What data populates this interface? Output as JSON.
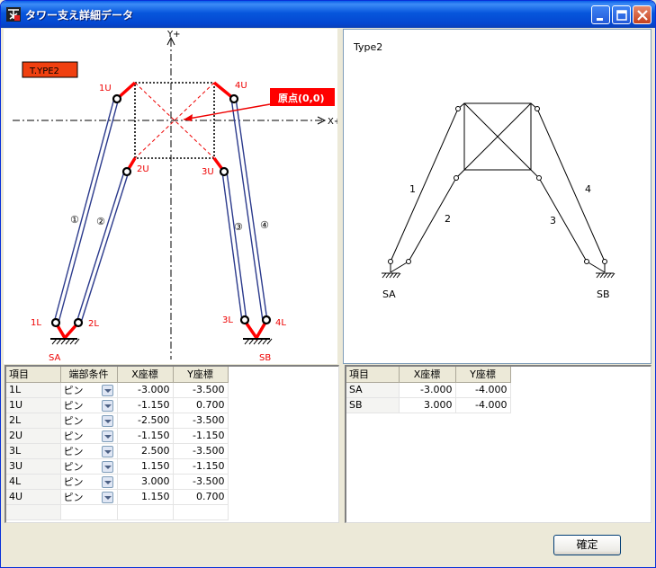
{
  "window": {
    "title": "タワー支え詳細データ"
  },
  "left_diagram": {
    "type_badge": "T.YPE2",
    "axis_y": "Y+",
    "axis_x": "X+",
    "origin_label": "原点(0,0)",
    "points": {
      "p1U": "1U",
      "p2U": "2U",
      "p3U": "3U",
      "p4U": "4U",
      "p1L": "1L",
      "p2L": "2L",
      "p3L": "3L",
      "p4L": "4L"
    },
    "members": {
      "m1": "①",
      "m2": "②",
      "m3": "③",
      "m4": "④"
    },
    "supports": {
      "sa": "SA",
      "sb": "SB"
    }
  },
  "right_diagram": {
    "title": "Type2",
    "members": {
      "m1": "1",
      "m2": "2",
      "m3": "3",
      "m4": "4"
    },
    "supports": {
      "sa": "SA",
      "sb": "SB"
    }
  },
  "point_table": {
    "headers": {
      "item": "項目",
      "cond": "端部条件",
      "x": "X座標",
      "y": "Y座標"
    },
    "rows": [
      {
        "item": "1L",
        "cond": "ピン",
        "x": "-3.000",
        "y": "-3.500"
      },
      {
        "item": "1U",
        "cond": "ピン",
        "x": "-1.150",
        "y": "0.700"
      },
      {
        "item": "2L",
        "cond": "ピン",
        "x": "-2.500",
        "y": "-3.500"
      },
      {
        "item": "2U",
        "cond": "ピン",
        "x": "-1.150",
        "y": "-1.150"
      },
      {
        "item": "3L",
        "cond": "ピン",
        "x": "2.500",
        "y": "-3.500"
      },
      {
        "item": "3U",
        "cond": "ピン",
        "x": "1.150",
        "y": "-1.150"
      },
      {
        "item": "4L",
        "cond": "ピン",
        "x": "3.000",
        "y": "-3.500"
      },
      {
        "item": "4U",
        "cond": "ピン",
        "x": "1.150",
        "y": "0.700"
      }
    ]
  },
  "support_table": {
    "headers": {
      "item": "項目",
      "x": "X座標",
      "y": "Y座標"
    },
    "rows": [
      {
        "item": "SA",
        "x": "-3.000",
        "y": "-4.000"
      },
      {
        "item": "SB",
        "x": "3.000",
        "y": "-4.000"
      }
    ]
  },
  "buttons": {
    "ok": "確定"
  },
  "colors": {
    "title_bar": "#0454d9",
    "accent_red": "#ff0000",
    "member_blue": "#2b3a8c",
    "frame": "#ece9d8"
  }
}
